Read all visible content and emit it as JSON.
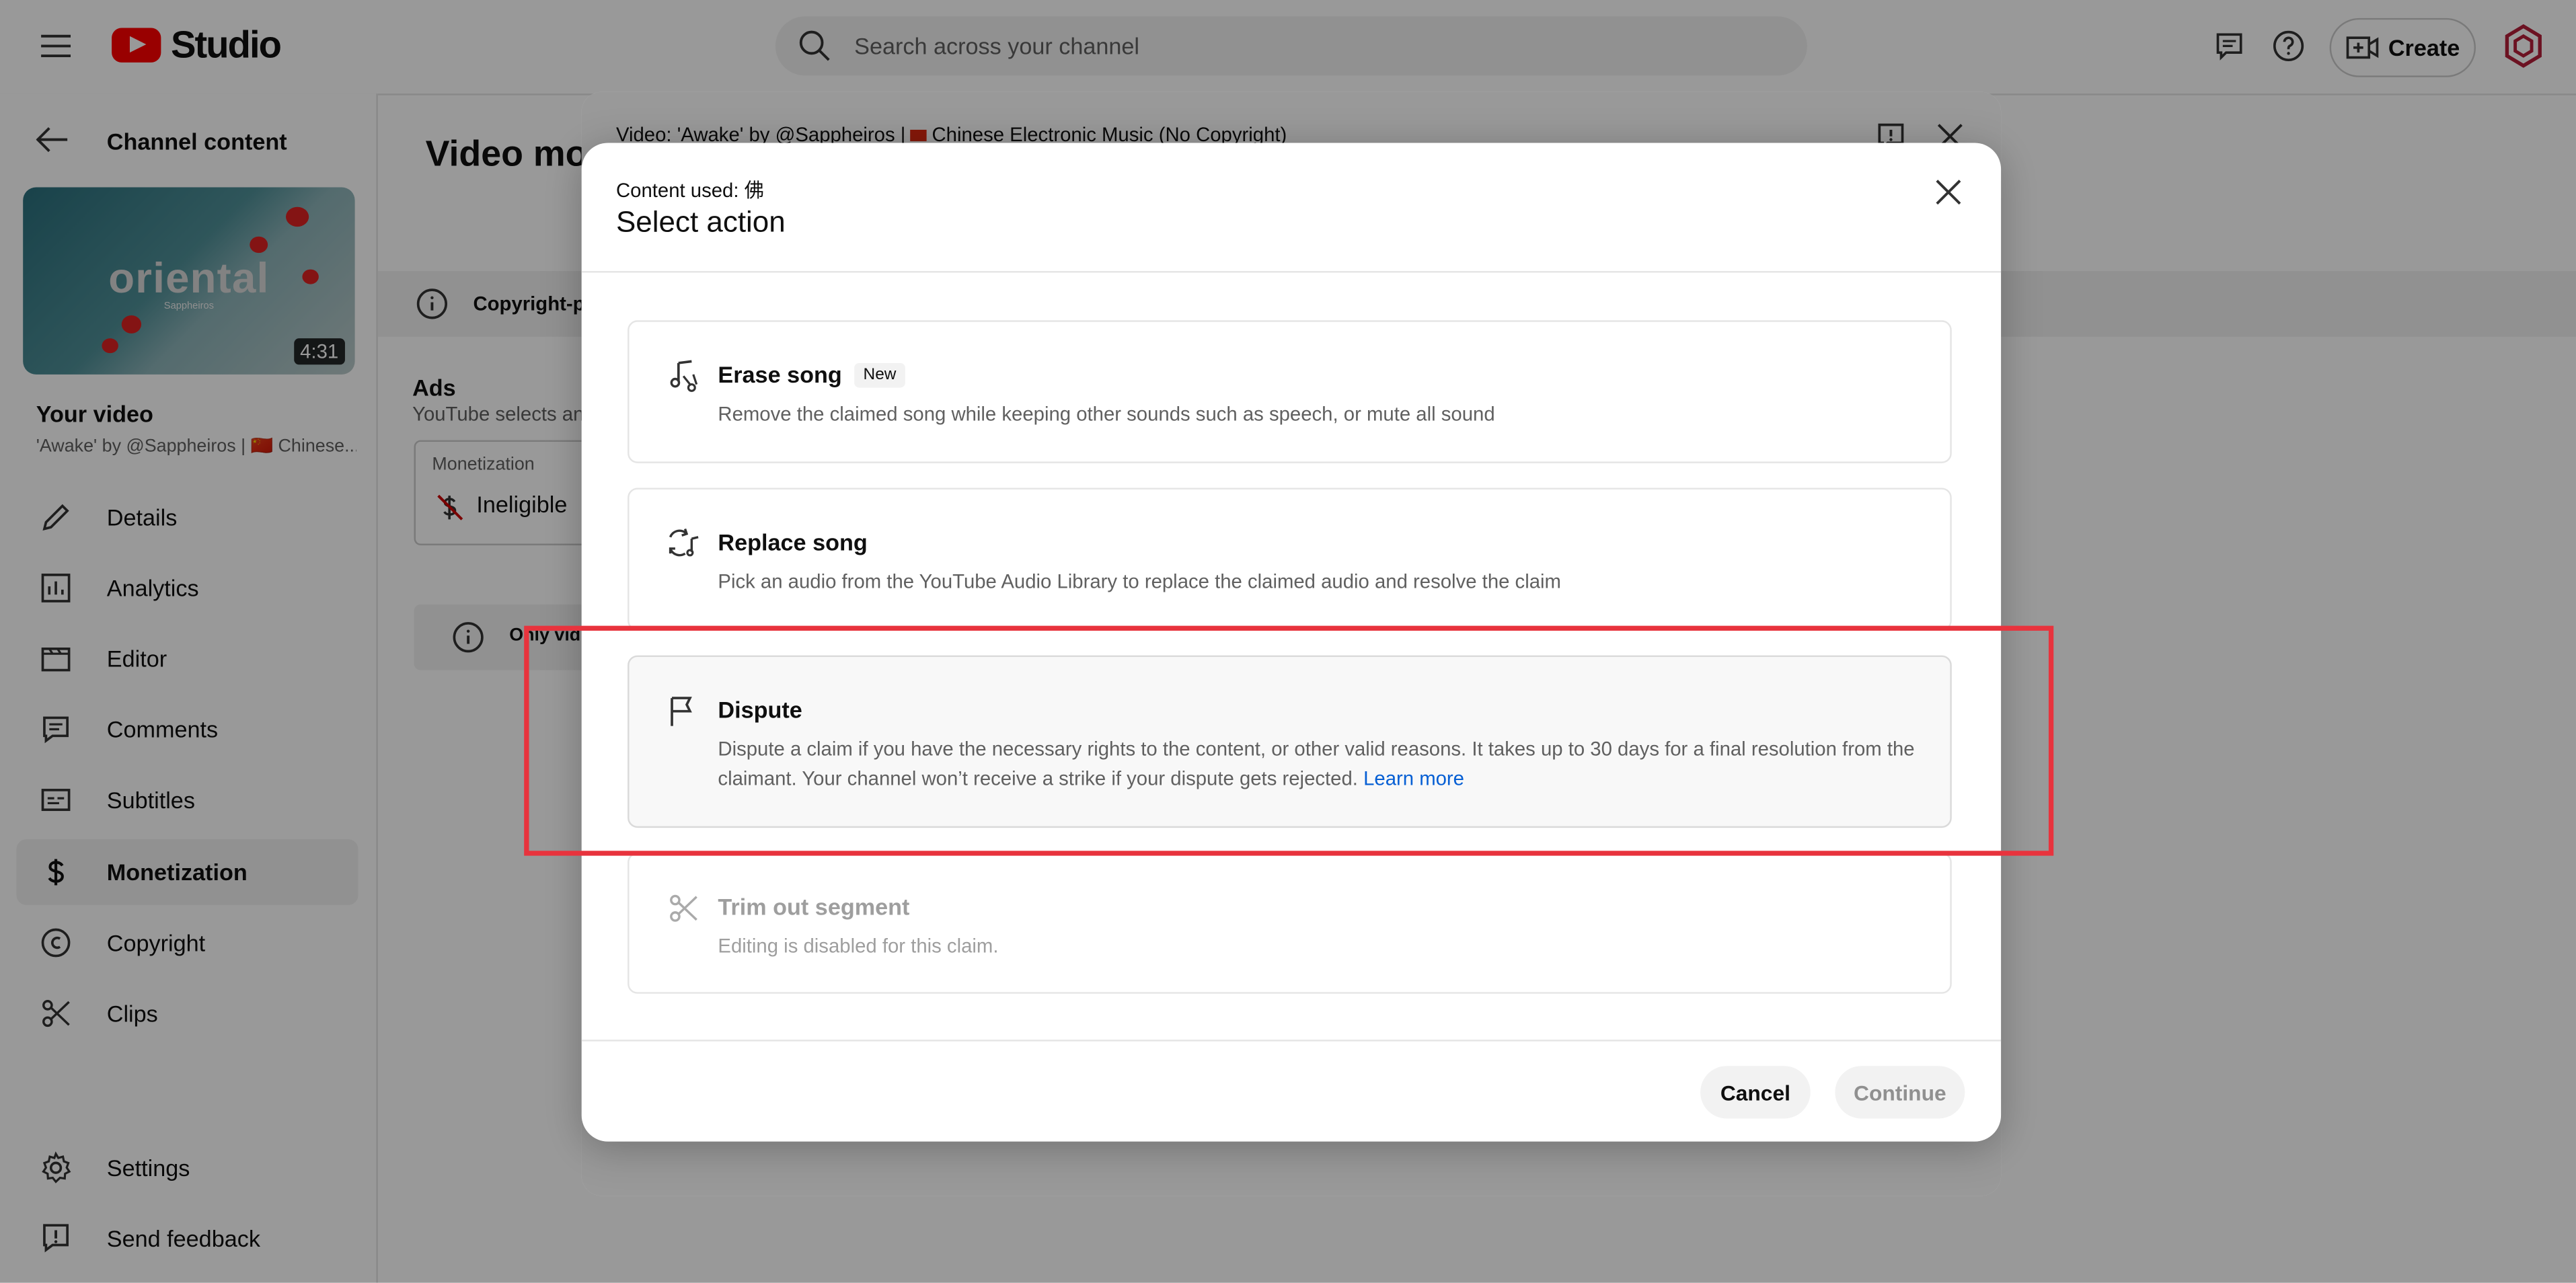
{
  "header": {
    "logo_text": "Studio",
    "search_placeholder": "Search across your channel",
    "create_label": "Create"
  },
  "sidebar": {
    "back_label": "Channel content",
    "thumbnail": {
      "title_text": "oriental",
      "subtitle_text": "Sappheiros",
      "duration": "4:31"
    },
    "your_video_label": "Your video",
    "video_name": "'Awake' by @Sappheiros | 🇨🇳 Chinese...",
    "items": [
      {
        "label": "Details",
        "icon": "pencil-icon"
      },
      {
        "label": "Analytics",
        "icon": "analytics-icon"
      },
      {
        "label": "Editor",
        "icon": "editor-icon"
      },
      {
        "label": "Comments",
        "icon": "comments-icon"
      },
      {
        "label": "Subtitles",
        "icon": "subtitles-icon"
      },
      {
        "label": "Monetization",
        "icon": "dollar-icon",
        "active": true
      },
      {
        "label": "Copyright",
        "icon": "copyright-icon"
      },
      {
        "label": "Clips",
        "icon": "scissors-icon"
      }
    ],
    "bottom_items": [
      {
        "label": "Settings",
        "icon": "gear-icon"
      },
      {
        "label": "Send feedback",
        "icon": "feedback-icon"
      }
    ]
  },
  "main": {
    "page_title": "Video mor",
    "banner_text": "Copyright-pr",
    "ads_title": "Ads",
    "ads_subtitle": "YouTube selects an",
    "monetization_label": "Monetization",
    "monetization_value": "Ineligible",
    "info_text": "Only vid"
  },
  "back_dialog": {
    "title_prefix": "Video: 'Awake' by @Sappheiros |",
    "title_suffix": "Chinese Electronic Music (No Copyright)"
  },
  "dialog": {
    "content_used": "Content used: 佛",
    "title": "Select action",
    "options": [
      {
        "title": "Erase song",
        "badge": "New",
        "description": "Remove the claimed song while keeping other sounds such as speech, or mute all sound"
      },
      {
        "title": "Replace song",
        "description": "Pick an audio from the YouTube Audio Library to replace the claimed audio and resolve the claim"
      },
      {
        "title": "Dispute",
        "description": "Dispute a claim if you have the necessary rights to the content, or other valid reasons. It takes up to 30 days for a final resolution from the claimant. Your channel won’t receive a strike if your dispute gets rejected.",
        "link": "Learn more",
        "selected": true
      },
      {
        "title": "Trim out segment",
        "description": "Editing is disabled for this claim.",
        "disabled": true
      }
    ],
    "cancel_label": "Cancel",
    "continue_label": "Continue"
  },
  "colors": {
    "highlight": "#e8333d",
    "accent": "#065fd4",
    "brand_red": "#ff0000"
  }
}
